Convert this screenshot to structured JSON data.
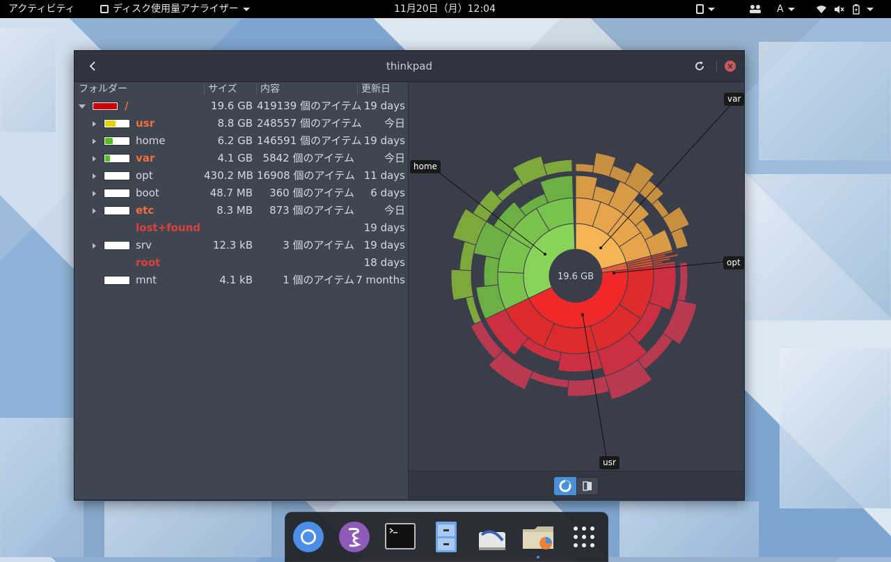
{
  "topbar": {
    "activities": "アクティビティ",
    "app_menu": "ディスク使用量アナライザー",
    "clock": "11月20日（月）12:04",
    "input_method": "A"
  },
  "window": {
    "title": "thinkpad"
  },
  "table": {
    "headers": {
      "folder": "フォルダー",
      "size": "サイズ",
      "contents": "内容",
      "modified": "更新日"
    },
    "rows": [
      {
        "name": "/",
        "size": "19.6 GB",
        "contents": "419139 個のアイテム",
        "modified": "19 days",
        "fill": 1.0,
        "color": "#cc0000",
        "style": "warn",
        "expander": "down"
      },
      {
        "name": "usr",
        "size": "8.8 GB",
        "contents": "248557 個のアイテム",
        "modified": "今日",
        "fill": 0.45,
        "color": "#e6d300",
        "style": "warn",
        "expander": "right"
      },
      {
        "name": "home",
        "size": "6.2 GB",
        "contents": "146591 個のアイテム",
        "modified": "19 days",
        "fill": 0.32,
        "color": "#4ec21a",
        "style": "normal",
        "expander": "right"
      },
      {
        "name": "var",
        "size": "4.1 GB",
        "contents": "5842 個のアイテム",
        "modified": "今日",
        "fill": 0.21,
        "color": "#4ec21a",
        "style": "warn",
        "expander": "right"
      },
      {
        "name": "opt",
        "size": "430.2 MB",
        "contents": "16908 個のアイテム",
        "modified": "11 days",
        "fill": 0.02,
        "color": "#4ec21a",
        "style": "normal",
        "expander": "right"
      },
      {
        "name": "boot",
        "size": "48.7 MB",
        "contents": "360 個のアイテム",
        "modified": "6 days",
        "fill": 0.0,
        "color": "#4ec21a",
        "style": "normal",
        "expander": "right"
      },
      {
        "name": "etc",
        "size": "8.3 MB",
        "contents": "873 個のアイテム",
        "modified": "今日",
        "fill": 0.0,
        "color": "#4ec21a",
        "style": "warn",
        "expander": "right"
      },
      {
        "name": "lost+found",
        "size": "",
        "contents": "",
        "modified": "19 days",
        "fill": null,
        "color": "",
        "style": "err",
        "expander": "none"
      },
      {
        "name": "srv",
        "size": "12.3 kB",
        "contents": "3 個のアイテム",
        "modified": "19 days",
        "fill": 0.0,
        "color": "#4ec21a",
        "style": "normal",
        "expander": "right"
      },
      {
        "name": "root",
        "size": "",
        "contents": "",
        "modified": "18 days",
        "fill": null,
        "color": "",
        "style": "err",
        "expander": "none"
      },
      {
        "name": "mnt",
        "size": "4.1 kB",
        "contents": "1 個のアイテム",
        "modified": "7 months",
        "fill": 0.0,
        "color": "#4ec21a",
        "style": "normal",
        "expander": "none"
      }
    ]
  },
  "chart_data": {
    "type": "sunburst",
    "center_label": "19.6 GB",
    "callouts": [
      "var",
      "home",
      "opt",
      "usr"
    ],
    "segments": [
      {
        "name": "usr",
        "value": 8.8,
        "color": "#ef2929"
      },
      {
        "name": "home",
        "value": 6.2,
        "color": "#8ae234"
      },
      {
        "name": "var",
        "value": 4.1,
        "color": "#fcaf3e"
      },
      {
        "name": "opt",
        "value": 0.43,
        "color": "#e06030"
      }
    ]
  },
  "dock": {
    "apps": [
      "chromium-icon",
      "emacs-icon",
      "terminal-icon",
      "file-cabinet-icon",
      "scanner-icon",
      "disk-usage-analyzer-icon",
      "show-applications-icon"
    ]
  },
  "colors": {
    "accent": "#4a90d9",
    "warn": "#f0703a",
    "error": "#e0413a"
  }
}
